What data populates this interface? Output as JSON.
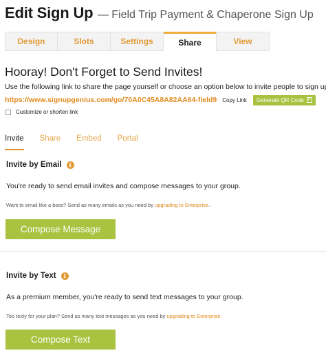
{
  "header": {
    "title": "Edit Sign Up",
    "subtitle": "— Field Trip Payment & Chaperone Sign Up"
  },
  "tabs": [
    {
      "label": "Design"
    },
    {
      "label": "Slots"
    },
    {
      "label": "Settings"
    },
    {
      "label": "Share"
    },
    {
      "label": "View"
    }
  ],
  "active_tab": "Share",
  "share": {
    "heading": "Hooray! Don't Forget to Send Invites!",
    "instructions": "Use the following link to share the page yourself or choose an option below to invite people to sign up.",
    "link": "https://www.signupgenius.com/go/70A0C45A8A82AA64-field9",
    "copy_label": "Copy Link",
    "qr_label": "Generate QR Code",
    "qr_icon": "qr-code-icon",
    "customize_label": "Customize or shorten link"
  },
  "subtabs": [
    {
      "label": "Invite"
    },
    {
      "label": "Share"
    },
    {
      "label": "Embed"
    },
    {
      "label": "Portal"
    }
  ],
  "active_subtab": "Invite",
  "email": {
    "heading": "Invite by Email",
    "info_icon": "info-icon",
    "description": "You're ready to send email invites and compose messages to your group.",
    "upsell_text": "Want to email like a boss? Send as many emails as you need by ",
    "upsell_link": "upgrading to Enterprise",
    "upsell_end": ".",
    "button": "Compose Message"
  },
  "text": {
    "heading": "Invite by Text",
    "info_icon": "info-icon",
    "description": "As a premium member, you're ready to send text messages to your group.",
    "upsell_text": "Too texty for your plan? Send as many text messages as you need by ",
    "upsell_link": "upgrading to Enterprise",
    "upsell_end": ".",
    "button": "Compose Text"
  },
  "colors": {
    "accent_orange": "#e09a35",
    "link_orange": "#e08a1e",
    "button_green": "#a9c23f"
  }
}
